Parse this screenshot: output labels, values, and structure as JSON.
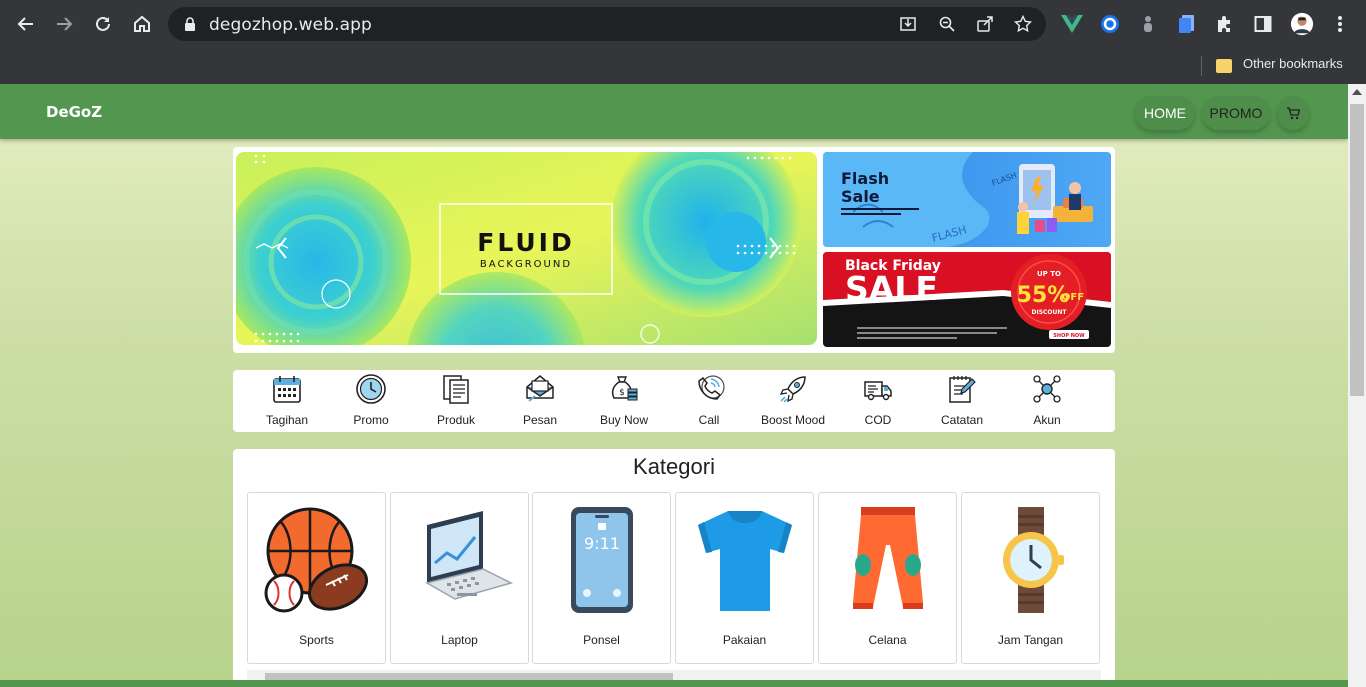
{
  "browser": {
    "url": "degozhop.web.app",
    "bookmarks": {
      "other_label": "Other bookmarks"
    }
  },
  "app": {
    "brand": "DeGoZ",
    "nav": {
      "home": "HOME",
      "promo": "PROMO"
    }
  },
  "banners": {
    "hero": {
      "title": "FLUID",
      "subtitle": "BACKGROUND"
    },
    "flash": {
      "line1": "Flash",
      "line2": "Sale"
    },
    "black_friday": {
      "line1": "Black Friday",
      "line2": "SALE",
      "badge_top": "UP TO",
      "badge_value": "55%",
      "badge_off": "OFF",
      "badge_bottom": "DISCOUNT",
      "cta": "SHOP NOW"
    }
  },
  "menu": [
    {
      "label": "Tagihan",
      "icon": "calendar-icon"
    },
    {
      "label": "Promo",
      "icon": "clock-icon"
    },
    {
      "label": "Produk",
      "icon": "documents-icon"
    },
    {
      "label": "Pesan",
      "icon": "envelope-icon"
    },
    {
      "label": "Buy Now",
      "icon": "money-bag-icon"
    },
    {
      "label": "Call",
      "icon": "phone-icon"
    },
    {
      "label": "Boost Mood",
      "icon": "rocket-icon"
    },
    {
      "label": "COD",
      "icon": "truck-icon"
    },
    {
      "label": "Catatan",
      "icon": "notes-icon"
    },
    {
      "label": "Akun",
      "icon": "network-icon"
    }
  ],
  "kategori": {
    "title": "Kategori",
    "items": [
      {
        "label": "Sports",
        "icon": "sports-balls-icon"
      },
      {
        "label": "Laptop",
        "icon": "laptop-icon"
      },
      {
        "label": "Ponsel",
        "icon": "phone-screen-icon"
      },
      {
        "label": "Pakaian",
        "icon": "tshirt-icon"
      },
      {
        "label": "Celana",
        "icon": "pants-icon"
      },
      {
        "label": "Jam Tangan",
        "icon": "watch-icon"
      }
    ]
  },
  "colors": {
    "nav_green": "#53964f",
    "chrome": "#35363a"
  }
}
